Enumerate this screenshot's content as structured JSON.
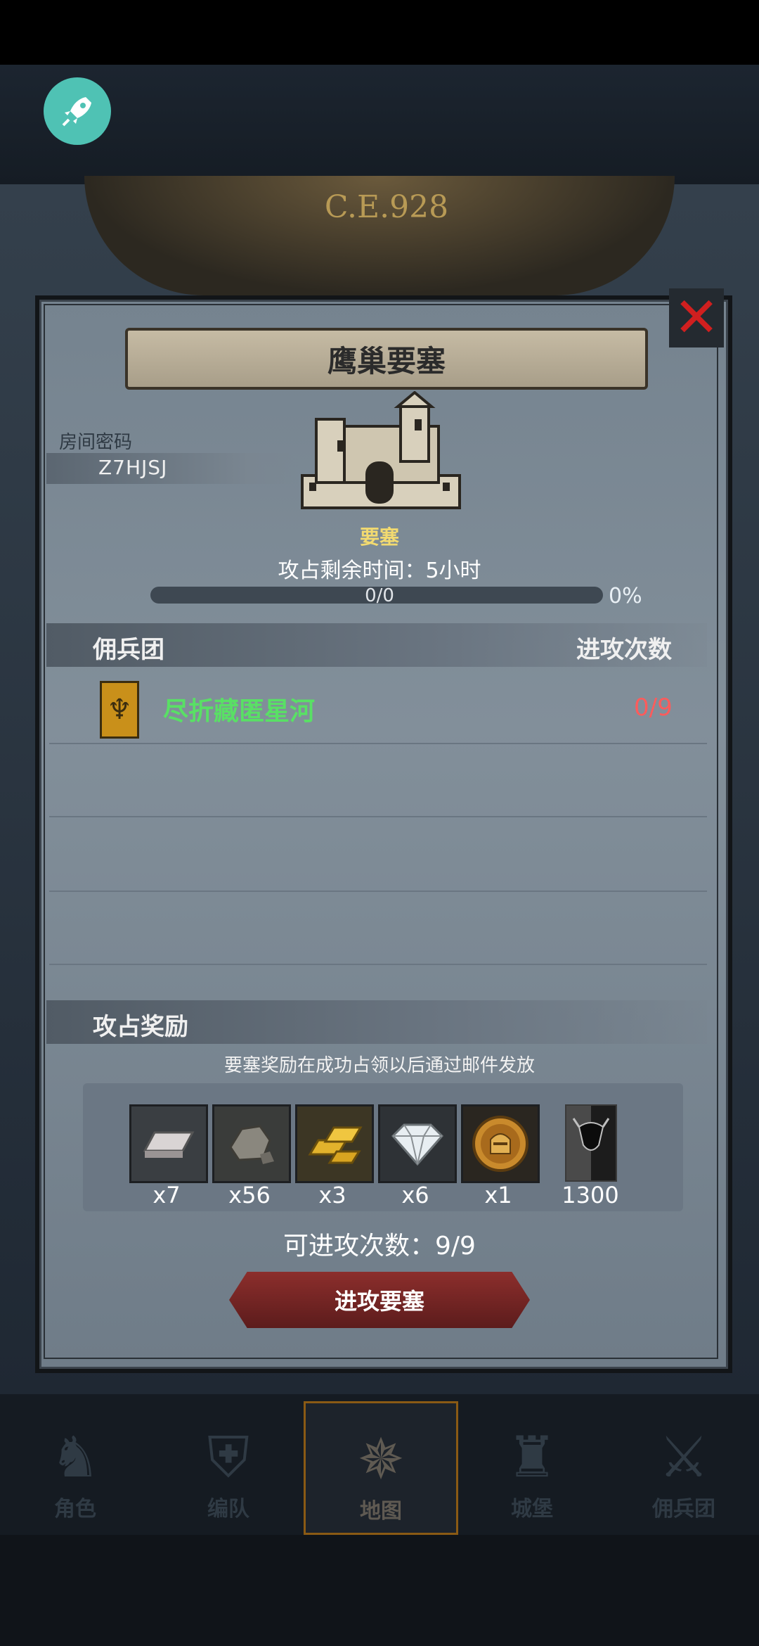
{
  "era": "C.E.928",
  "modal": {
    "title": "鹰巢要塞",
    "room_label": "房间密码",
    "room_code": "Z7HJSJ",
    "fortress_label": "要塞",
    "time_remaining": "攻占剩余时间：5小时",
    "progress_text": "0/0",
    "progress_percent": "0%",
    "progress_fraction": 0,
    "sections": {
      "mercenary": "佣兵团",
      "attack_count": "进攻次数",
      "rewards": "攻占奖励"
    },
    "mercenary_rows": [
      {
        "name": "尽折藏匿星河",
        "count": "0/9"
      }
    ],
    "reward_note": "要塞奖励在成功占领以后通过邮件发放",
    "rewards": [
      {
        "icon": "silver-ingot-icon",
        "qty": "x7"
      },
      {
        "icon": "stone-ore-icon",
        "qty": "x56"
      },
      {
        "icon": "gold-bars-icon",
        "qty": "x3"
      },
      {
        "icon": "diamond-icon",
        "qty": "x6"
      },
      {
        "icon": "knight-coin-icon",
        "qty": "x1"
      },
      {
        "icon": "bull-banner-icon",
        "qty": "1300"
      }
    ],
    "attack_count_text": "可进攻次数：9/9",
    "attack_button": "进攻要塞",
    "close_glyph": "✕"
  },
  "nav": [
    {
      "label": "角色",
      "icon": "knight-icon",
      "glyph": "♞",
      "active": false
    },
    {
      "label": "编队",
      "icon": "helmet-icon",
      "glyph": "⛨",
      "active": false
    },
    {
      "label": "地图",
      "icon": "compass-icon",
      "glyph": "✵",
      "active": true
    },
    {
      "label": "城堡",
      "icon": "castle-icon",
      "glyph": "♜",
      "active": false
    },
    {
      "label": "佣兵团",
      "icon": "mercenary-icon",
      "glyph": "⚔",
      "active": false
    }
  ],
  "colors": {
    "accent_green": "#59e065",
    "accent_red": "#ff5b5b",
    "fortress_gold": "#f2da70",
    "rocket_teal": "#4fc2b4"
  }
}
